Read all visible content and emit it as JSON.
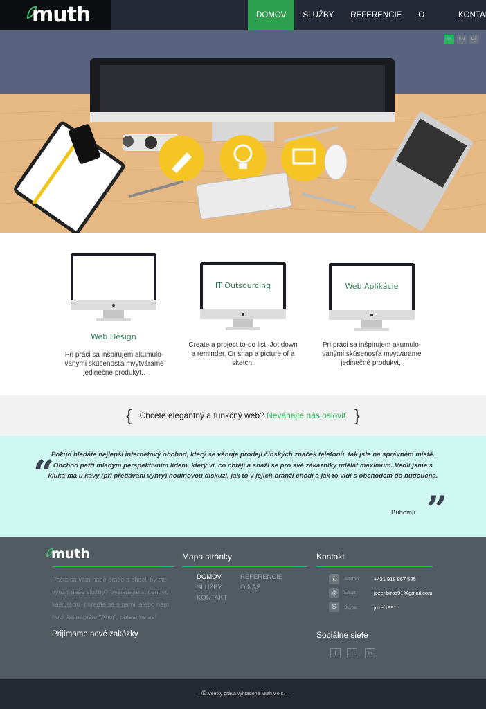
{
  "header": {
    "logo_text": "muth",
    "nav": [
      "DOMOV",
      "SLUŽBY",
      "REFERENCIE",
      "O NÁS",
      "KONTAKT"
    ],
    "active_index": 0,
    "languages": [
      "SK",
      "EN",
      "DE"
    ]
  },
  "services": [
    {
      "screen_text": "",
      "title": "Web Design",
      "desc": "Pri práci sa inšpirujem akumulo-vanými skúsenosťa mvytvárame jedinečné produkyt,."
    },
    {
      "screen_text": "IT Outsourcing",
      "title": "",
      "desc": "Create a project to-do list. Jot down a reminder. Or snap a picture of a sketch."
    },
    {
      "screen_text": "Web Aplikácie",
      "title": "",
      "desc": "Pri práci sa inšpirujem akumulo-vanými skúsenosťa mvytvárame jedinečné produkyt,."
    }
  ],
  "cta": {
    "text": "Chcete elegantný a funkčný web?",
    "link": "Neváhajte nás osloviť"
  },
  "testimonial": {
    "quote": "Pokud hledáte nejlepší internetový obchod, který se věnuje prodeji čínských značek telefonů, tak jste na správném místě. Obchod patří mladým perspektivním lidem, který ví, co chtějí a snaží se pro své zákazníky udělat maximum. Vedlí jsme s kluka-ma u kávy (při předávání výhry) hodinovou diskuzi, jak to v jejich branži chodí a jak to vidí s obchodem do budoucna.",
    "author": "Bubomir"
  },
  "footer": {
    "logo_text": "muth",
    "desc": "Páčia sa vám naše práce a chceli by ste využiť naše služby? Vyžiadajte si cenovú kalkuláciu, poraďte sa s nami, alebo nám hoci iba napíšte \"Ahoj\", potešíme sa!",
    "orders_title": "Prijímame nové zakázky",
    "sitemap_title": "Mapa stránky",
    "sitemap_col1": [
      "DOMOV",
      "SLUŽBY",
      "KONTAKT"
    ],
    "sitemap_col2": [
      "REFERENCIE",
      "O NÁS"
    ],
    "contact_title": "Kontakt",
    "contacts": [
      {
        "icon": "phone-icon",
        "label": "Telefón:",
        "value": "+421 918 867 525"
      },
      {
        "icon": "email-icon",
        "label": "Email:",
        "value": "jozef.biros91@gmail.com"
      },
      {
        "icon": "skype-icon",
        "label": "Skype:",
        "value": "jozef1991"
      }
    ],
    "social_title": "Sociálne siete",
    "social": [
      "facebook-icon",
      "twitter-icon",
      "linkedin-icon"
    ]
  },
  "copyright": "Všetky práva vyhradené Muth v.o.s."
}
